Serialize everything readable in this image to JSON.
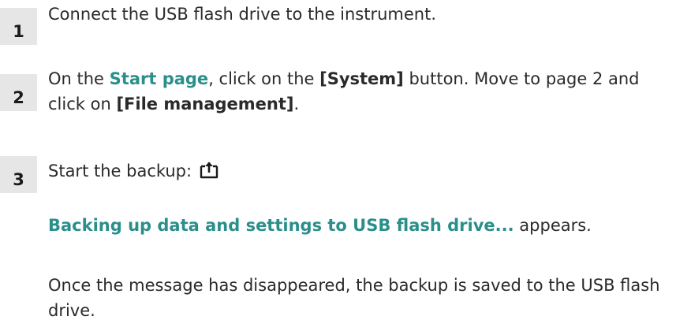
{
  "steps": [
    {
      "number": "1",
      "text": "Connect the USB flash drive to the instrument."
    },
    {
      "number": "2",
      "t1": "On the ",
      "start_page": "Start page",
      "t2": ", click on the ",
      "system_btn": "[System]",
      "t3": " button. Move to page 2 and click on ",
      "file_mgmt": "[File management]",
      "t4": "."
    },
    {
      "number": "3",
      "text": "Start the backup: ",
      "icon": "export-upload-icon"
    }
  ],
  "message": {
    "highlight": "Backing up data and settings to USB flash drive...",
    "suffix": " appears."
  },
  "result": "Once the message has disappeared, the backup is saved to the USB flash drive.",
  "colors": {
    "highlight": "#2a8f8a",
    "step_box": "#e6e6e6",
    "text": "#2a2a2a"
  }
}
